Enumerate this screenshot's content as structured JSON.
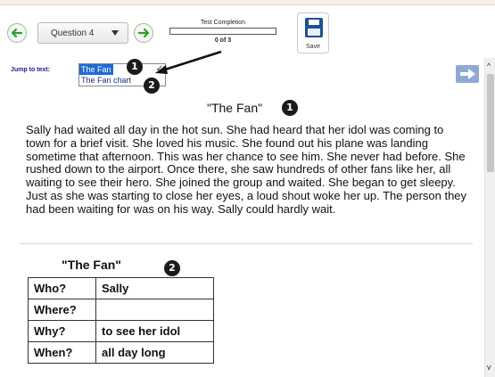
{
  "toolbar": {
    "question_select": "Question 4",
    "progress": {
      "label": "Test Completion",
      "count_text": "0 of 3",
      "fraction": 0
    },
    "save_label": "Save"
  },
  "jump": {
    "label": "Jump to text:",
    "selected": "The Fan",
    "options": [
      "The Fan chart"
    ]
  },
  "badges": {
    "one": "1",
    "two": "2"
  },
  "passage": {
    "title": "\"The Fan\"",
    "text": "Sally had waited all day in the hot sun.  She had heard that her idol was coming to town for a brief visit.  She loved his music.  She found out his plane was landing sometime that afternoon.  This was her chance to see him.  She never had before.  She rushed down to the airport.  Once there, she saw hundreds of other fans like her, all waiting to see their hero.  She joined the group and waited.  She began to get sleepy.  Just as she was starting to close her eyes, a loud shout woke her up.  The person they had been waiting for was on his way.  Sally could hardly wait."
  },
  "chart": {
    "title": "\"The Fan\"",
    "rows": [
      {
        "k": "Who?",
        "v": "Sally"
      },
      {
        "k": "Where?",
        "v": ""
      },
      {
        "k": "Why?",
        "v": "to see her idol"
      },
      {
        "k": "When?",
        "v": "all day long"
      }
    ]
  },
  "icons": {
    "prev": "left-arrow-icon",
    "next": "right-arrow-icon",
    "save": "floppy-disk-icon",
    "side": "right-arrow-icon"
  },
  "colors": {
    "accent": "#1e4f95",
    "nav_green": "#2f9a2f",
    "link_blue": "#1a1a8c",
    "select_blue": "#1f6bd6"
  }
}
